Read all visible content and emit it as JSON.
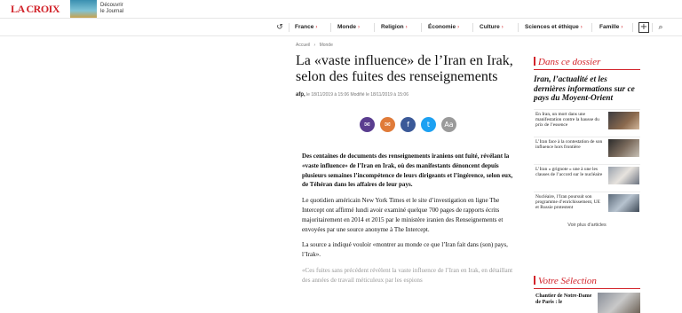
{
  "header": {
    "logo": "LA CROIX",
    "decouvrir_line1": "Découvrir",
    "decouvrir_line2": "le Journal"
  },
  "nav": {
    "items": [
      {
        "label": "France",
        "chevron": "›"
      },
      {
        "label": "Monde",
        "chevron": "›"
      },
      {
        "label": "Religion",
        "chevron": "›"
      },
      {
        "label": "Économie",
        "chevron": "›"
      },
      {
        "label": "Culture",
        "chevron": "›"
      },
      {
        "label": "Sciences et éthique",
        "chevron": "›"
      },
      {
        "label": "Famille",
        "chevron": "›"
      }
    ],
    "back_icon": "↺",
    "plus_icon": "+",
    "search_icon": "⌕"
  },
  "article": {
    "breadcrumb": [
      "Accueil",
      "›",
      "Monde"
    ],
    "title": "La «vaste influence» de l’Iran en Irak, selon des fuites des renseignements",
    "author": "afp,",
    "date_text": "le 18/11/2019 à 15:06 Modifié le 18/11/2019 à 15:06",
    "share_icons": [
      "comment-icon",
      "mail-icon",
      "facebook-icon",
      "twitter-icon",
      "font-size-icon"
    ],
    "share_glyphs": [
      "✉",
      "✉",
      "f",
      "t",
      "Aa"
    ],
    "share_colors": [
      "#5a3d8f",
      "#e07b39",
      "#3b5998",
      "#1da1f2",
      "#9a9a9a"
    ],
    "paragraphs": [
      "Des centaines de documents des renseignements iraniens ont fuité, révélant la «vaste influence» de l’Iran en Irak, où des manifestants dénoncent depuis plusieurs semaines l’incompétence de leurs dirigeants et l’ingérence, selon eux, de Téhéran dans les affaires de leur pays.",
      "Le quotidien américain New York Times et le site d’investigation en ligne The Intercept ont affirmé lundi avoir examiné quelque 700 pages de rapports écrits majoritairement en 2014 et 2015 par le ministère iranien des Renseignements et envoyées par une source anonyme à The Intercept.",
      "La source a indiqué vouloir «montrer au monde ce que l’Iran fait dans (son) pays, l’Irak».",
      "«Ces fuites sans précédent révèlent la vaste influence de l’Iran en Irak, en détaillant des années de travail méticuleux par les espions"
    ]
  },
  "sidebar": {
    "dossier_heading": "Dans ce dossier",
    "dossier_title": "Iran, l’actualité et les dernières informations sur ce pays du Moyent-Orient",
    "items": [
      {
        "text": "En Iran, un mort dans une manifestation contre la hausse du prix de l’essence"
      },
      {
        "text": "L’Iran face à la contestation de son influence hors frontière"
      },
      {
        "text": "L’Iran « grignote » une à une les clauses de l’accord sur le nucléaire"
      },
      {
        "text": "Nucléaire, l’Iran poursuit son programme d’enrichissement, UE et Russie protestent"
      }
    ],
    "see_more": "Voir plus d’articles",
    "selection_heading": "Votre Sélection",
    "selection_item": "Chantier de Notre-Dame de Paris : le"
  }
}
